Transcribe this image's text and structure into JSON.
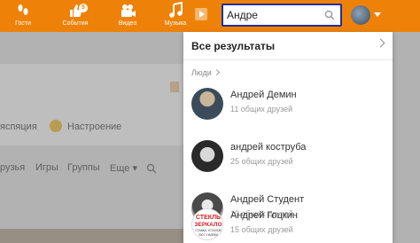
{
  "nav": {
    "items": [
      {
        "label": "Гости",
        "icon": "footprints-icon"
      },
      {
        "label": "События",
        "icon": "like-icon",
        "badge": "5"
      },
      {
        "label": "Видео",
        "icon": "video-camera-icon"
      },
      {
        "label": "Музыка",
        "icon": "music-note-icon"
      }
    ]
  },
  "search": {
    "value": "Андре",
    "icon": "search-icon"
  },
  "background": {
    "tab_partial": "яспяция",
    "mood": "Настроение",
    "menu_items": [
      "рузья",
      "Игры",
      "Группы",
      "Еще ▾"
    ]
  },
  "dropdown": {
    "all_results": "Все результаты",
    "section": "Люди",
    "people": [
      {
        "name": "Андрей Демин",
        "mutual": "11 общих друзей",
        "avatar": "photo"
      },
      {
        "name": "андрей коструба",
        "mutual": "25 общих друзей",
        "avatar": "photo"
      },
      {
        "name": "Андрей Студент",
        "mutual": "19 общих друзей",
        "avatar": "photo"
      },
      {
        "name": "Андрей Гоцкин",
        "mutual": "15 общих друзей",
        "avatar": "logo",
        "logo_text": [
          "СТЕКЛЬ",
          "ЗЕРКАЛО",
          "СТАВКА. УСТАНОВ",
          "000 Г. НАЗЕКИ"
        ]
      }
    ]
  },
  "colors": {
    "brand": "#ee8208",
    "search_border": "#1f2f9c"
  }
}
